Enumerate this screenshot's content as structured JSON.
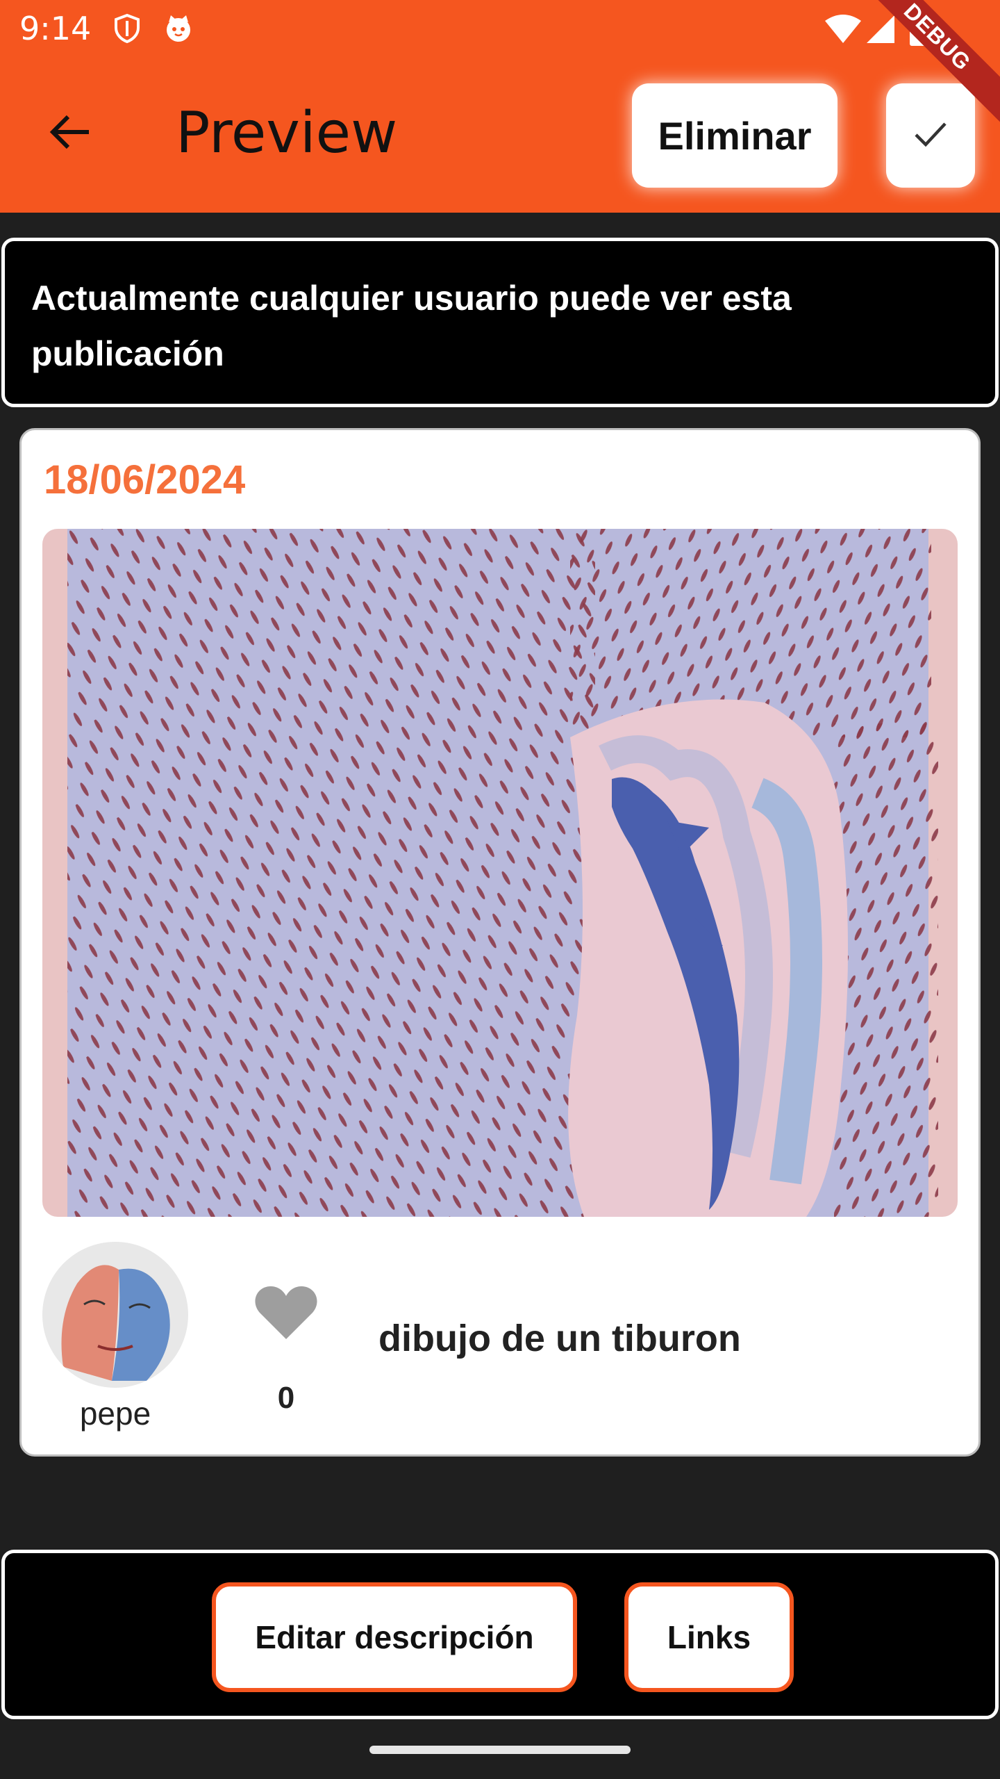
{
  "status_bar": {
    "time": "9:14",
    "icons": [
      "shield-icon",
      "cat-face-icon",
      "wifi-icon",
      "signal-icon",
      "battery-icon"
    ]
  },
  "app_bar": {
    "title": "Preview",
    "back_icon": "arrow-back-icon",
    "delete_label": "Eliminar",
    "confirm_icon": "check-icon",
    "debug_label": "DEBUG",
    "background": "#f5561f"
  },
  "info_banner": {
    "text": "Actualmente cualquier usuario puede ver esta publicación"
  },
  "post": {
    "date": "18/06/2024",
    "date_color": "#f5703b",
    "image_alt": "shark among school of fish illustration",
    "author": "pepe",
    "likes": "0",
    "description": "dibujo de un tiburon"
  },
  "bottom_actions": {
    "edit_label": "Editar descripción",
    "links_label": "Links",
    "accent": "#f5561f"
  }
}
